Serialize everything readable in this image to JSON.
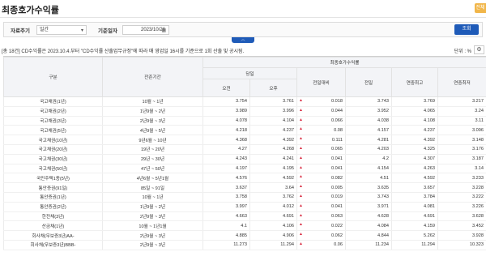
{
  "page": {
    "title": "최종호가수익률",
    "badge": "전체보"
  },
  "filter": {
    "period_label": "자료주기",
    "period_value": "일간",
    "date_label": "기준일자",
    "date_value": "2023/10/26",
    "search_label": "조회"
  },
  "collapse_icon": "︿",
  "notice": "[총 18건] CD수익률은 2023.10.4.부터 \"CD수익률 산출업무규정\"에 따라 매 영업일 16시를 기준으로 1회 산출 및 공시됨.",
  "unit": "단위 : %",
  "table": {
    "group_header": "최종호가수익률",
    "headers": {
      "type": "구분",
      "maturity": "잔존기간",
      "today": "당일",
      "am": "오전",
      "pm": "오후",
      "change": "전일대비",
      "prev": "전일",
      "high": "연중최고",
      "low": "연중최저"
    },
    "rows": [
      {
        "type": "국고채권(1년)",
        "maturity": "10월 ~ 1년",
        "am": "3.754",
        "pm": "3.761",
        "change": "0.018",
        "prev": "3.743",
        "high": "3.769",
        "low": "3.217"
      },
      {
        "type": "국고채권(2년)",
        "maturity": "1년9월 ~ 2년",
        "am": "3.989",
        "pm": "3.996",
        "change": "0.044",
        "prev": "3.952",
        "high": "4.065",
        "low": "3.24"
      },
      {
        "type": "국고채권(3년)",
        "maturity": "2년9월 ~ 3년",
        "am": "4.078",
        "pm": "4.104",
        "change": "0.066",
        "prev": "4.038",
        "high": "4.108",
        "low": "3.11"
      },
      {
        "type": "국고채권(5년)",
        "maturity": "4년9월 ~ 5년",
        "am": "4.218",
        "pm": "4.237",
        "change": "0.08",
        "prev": "4.157",
        "high": "4.237",
        "low": "3.096"
      },
      {
        "type": "국고채권(10년)",
        "maturity": "9년6월 ~ 10년",
        "am": "4.368",
        "pm": "4.392",
        "change": "0.111",
        "prev": "4.281",
        "high": "4.392",
        "low": "3.148"
      },
      {
        "type": "국고채권(20년)",
        "maturity": "19년 ~ 20년",
        "am": "4.27",
        "pm": "4.268",
        "change": "0.065",
        "prev": "4.203",
        "high": "4.325",
        "low": "3.176"
      },
      {
        "type": "국고채권(30년)",
        "maturity": "29년 ~ 30년",
        "am": "4.243",
        "pm": "4.241",
        "change": "0.041",
        "prev": "4.2",
        "high": "4.307",
        "low": "3.187"
      },
      {
        "type": "국고채권(50년)",
        "maturity": "47년 ~ 50년",
        "am": "4.197",
        "pm": "4.195",
        "change": "0.041",
        "prev": "4.154",
        "high": "4.263",
        "low": "3.14"
      },
      {
        "type": "국민주택1종(5년)",
        "maturity": "4년6월 ~ 5년1월",
        "am": "4.576",
        "pm": "4.592",
        "change": "0.082",
        "prev": "4.51",
        "high": "4.592",
        "low": "3.233"
      },
      {
        "type": "통안증권(91일)",
        "maturity": "85일 ~ 91일",
        "am": "3.637",
        "pm": "3.64",
        "change": "0.005",
        "prev": "3.635",
        "high": "3.657",
        "low": "3.228"
      },
      {
        "type": "통안증권(1년)",
        "maturity": "10월 ~ 1년",
        "am": "3.758",
        "pm": "3.762",
        "change": "0.019",
        "prev": "3.743",
        "high": "3.784",
        "low": "3.222"
      },
      {
        "type": "통안증권(2년)",
        "maturity": "1년9월 ~ 2년",
        "am": "3.997",
        "pm": "4.012",
        "change": "0.041",
        "prev": "3.971",
        "high": "4.081",
        "low": "3.226"
      },
      {
        "type": "한전채(3년)",
        "maturity": "2년9월 ~ 3년",
        "am": "4.663",
        "pm": "4.691",
        "change": "0.063",
        "prev": "4.628",
        "high": "4.691",
        "low": "3.628"
      },
      {
        "type": "산금채(1년)",
        "maturity": "10월 ~ 1년1월",
        "am": "4.1",
        "pm": "4.106",
        "change": "0.022",
        "prev": "4.084",
        "high": "4.159",
        "low": "3.452"
      },
      {
        "type": "회사채(무보증3년)AA-",
        "maturity": "2년9월 ~ 3년",
        "am": "4.885",
        "pm": "4.906",
        "change": "0.062",
        "prev": "4.844",
        "high": "5.262",
        "low": "3.928"
      },
      {
        "type": "회사채(무보증3년)BBB-",
        "maturity": "2년9월 ~ 3년",
        "am": "11.273",
        "pm": "11.294",
        "change": "0.06",
        "prev": "11.234",
        "high": "11.294",
        "low": "10.323"
      }
    ]
  },
  "colors": {
    "accent": "#1f5bb8",
    "badge": "#f1b64a",
    "up": "#d7263d",
    "header_bg": "#f3f4f7"
  }
}
